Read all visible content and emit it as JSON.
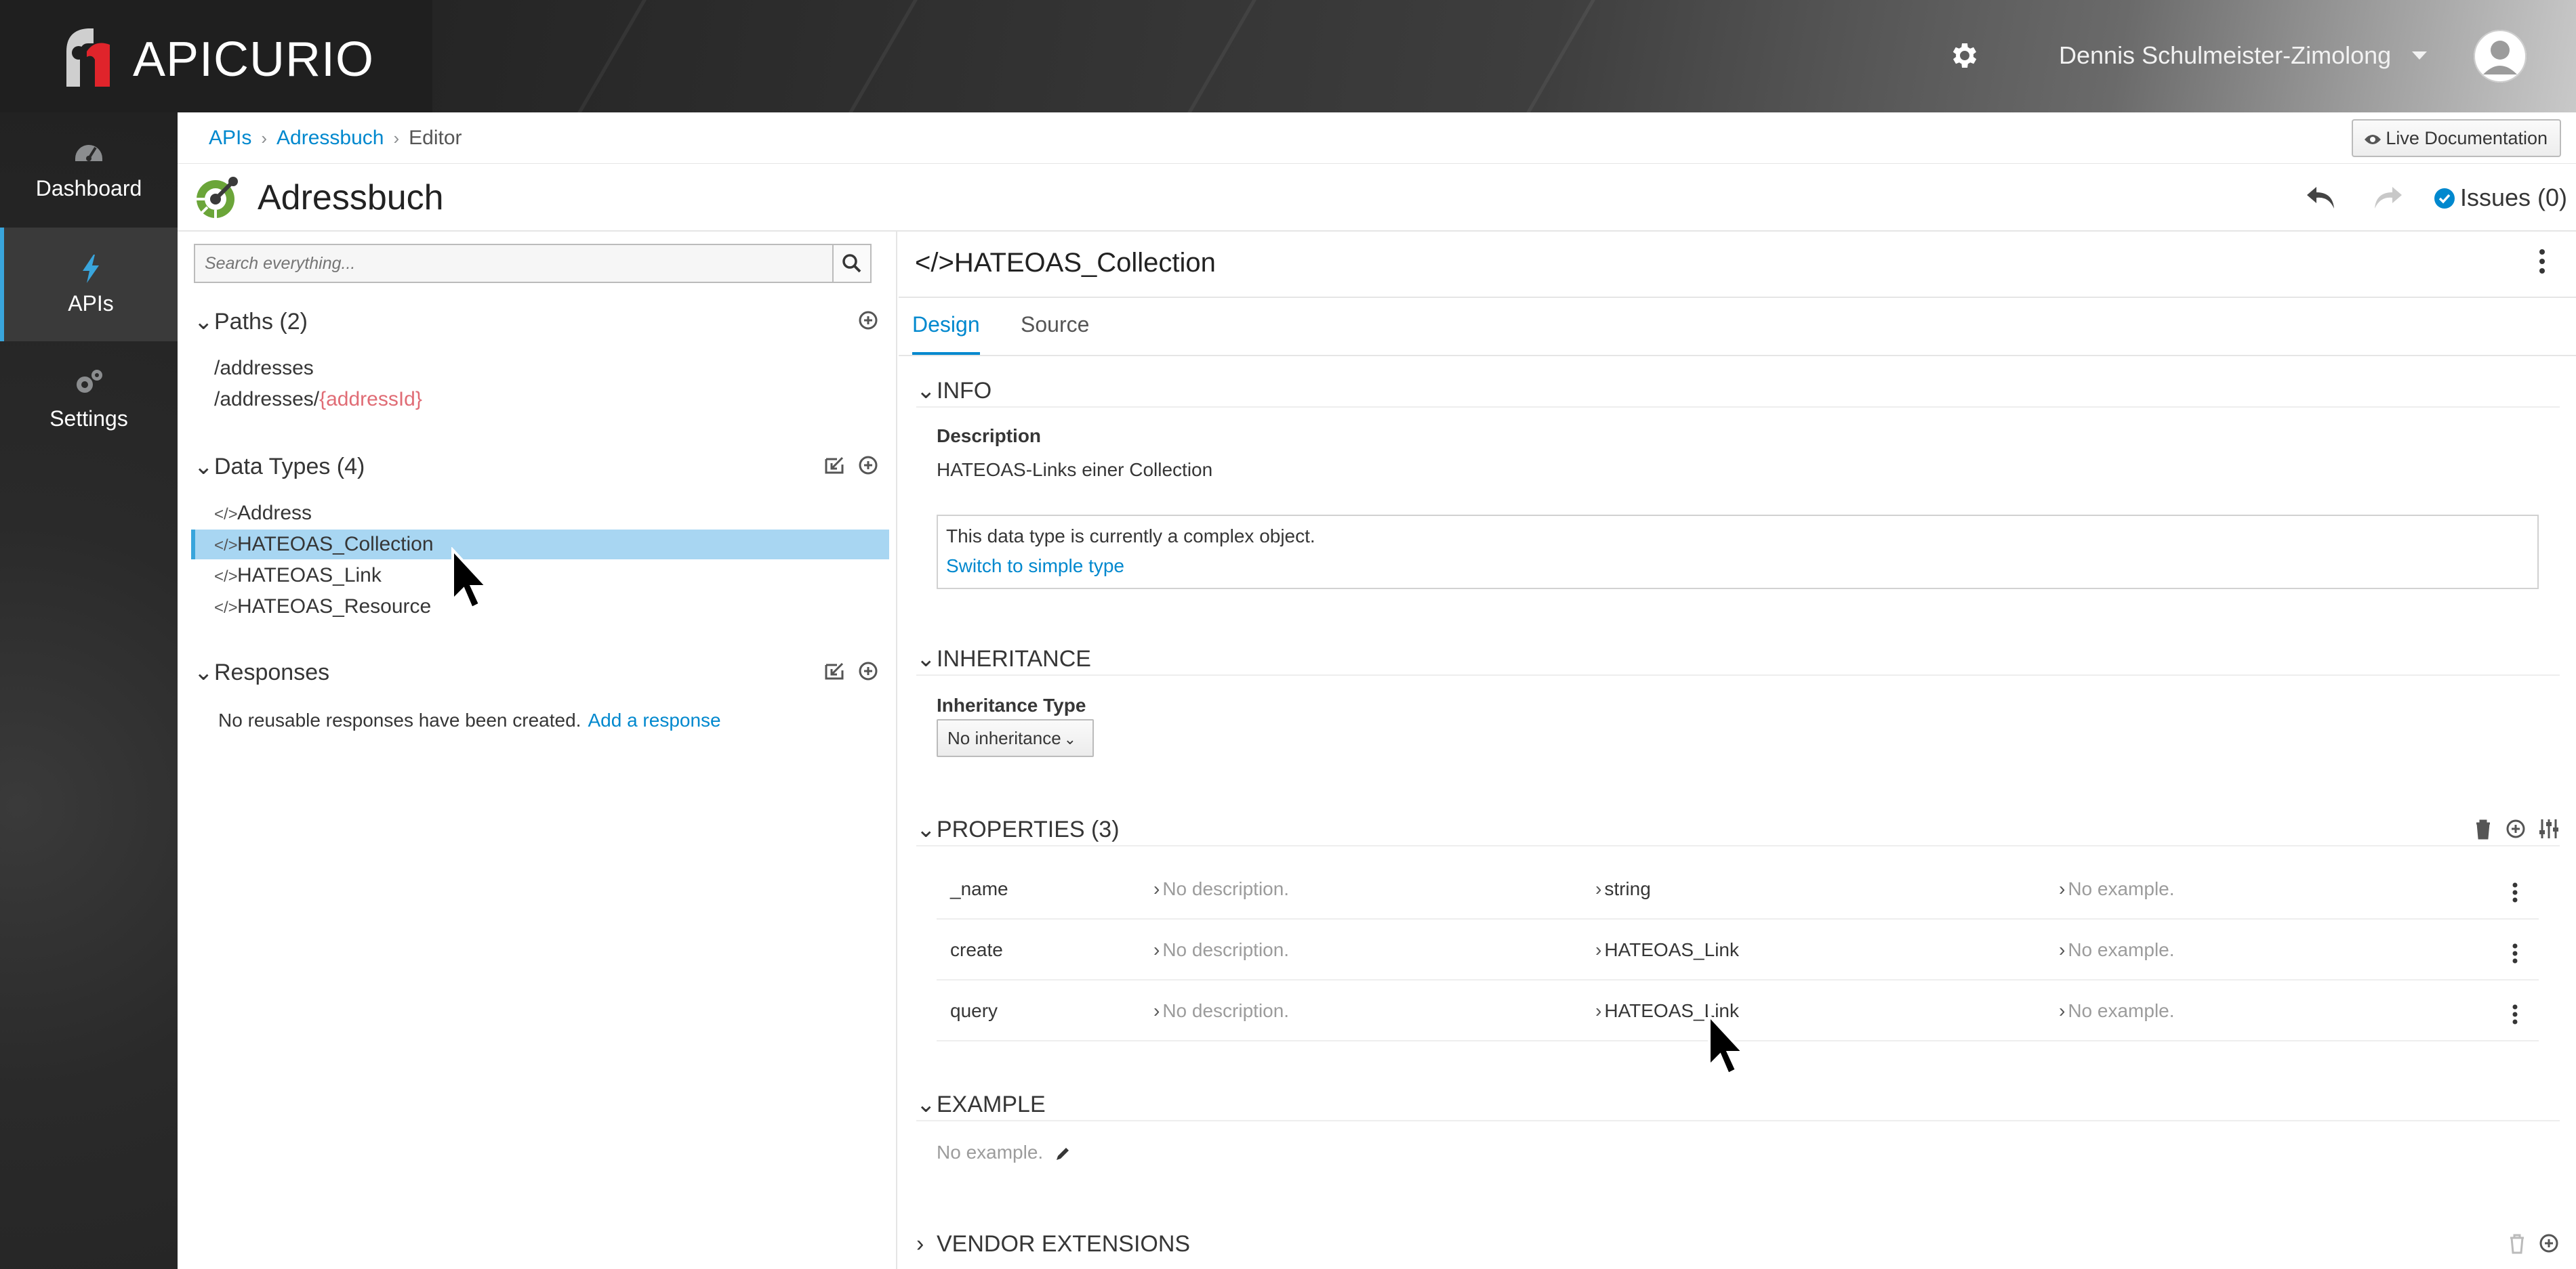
{
  "app": {
    "brand": "APICURIO",
    "user_name": "Dennis Schulmeister-Zimolong"
  },
  "leftnav": {
    "items": [
      {
        "label": "Dashboard",
        "icon": "dashboard-icon"
      },
      {
        "label": "APIs",
        "icon": "bolt-icon"
      },
      {
        "label": "Settings",
        "icon": "gears-icon"
      }
    ]
  },
  "breadcrumb": {
    "items": [
      "APIs",
      "Adressbuch",
      "Editor"
    ],
    "live_doc": "Live Documentation"
  },
  "title": {
    "api_name": "Adressbuch",
    "issues": "Issues (0)"
  },
  "navigator": {
    "search_placeholder": "Search everything...",
    "paths": {
      "title": "Paths (2)",
      "items": [
        {
          "prefix": "/addresses",
          "param": ""
        },
        {
          "prefix": "/addresses/",
          "param": "{addressId}"
        }
      ]
    },
    "data_types": {
      "title": "Data Types (4)",
      "items": [
        "Address",
        "HATEOAS_Collection",
        "HATEOAS_Link",
        "HATEOAS_Resource"
      ],
      "selected": "HATEOAS_Collection"
    },
    "responses": {
      "title": "Responses",
      "empty_text": "No reusable responses have been created.",
      "add_link": "Add a response"
    }
  },
  "editor": {
    "title": "HATEOAS_Collection",
    "tabs": [
      {
        "label": "Design",
        "active": true
      },
      {
        "label": "Source",
        "active": false
      }
    ],
    "info": {
      "heading": "INFO",
      "description_label": "Description",
      "description": "HATEOAS-Links einer Collection",
      "complex_msg": "This data type is currently a complex object.",
      "switch_link": "Switch to simple type"
    },
    "inheritance": {
      "heading": "INHERITANCE",
      "label": "Inheritance Type",
      "value": "No inheritance"
    },
    "properties": {
      "heading": "PROPERTIES (3)",
      "rows": [
        {
          "name": "_name",
          "description": "No description.",
          "type": "string",
          "example": "No example."
        },
        {
          "name": "create",
          "description": "No description.",
          "type": "HATEOAS_Link",
          "example": "No example."
        },
        {
          "name": "query",
          "description": "No description.",
          "type": "HATEOAS_Link",
          "example": "No example."
        }
      ]
    },
    "example": {
      "heading": "EXAMPLE",
      "text": "No example."
    },
    "vendor_extensions": {
      "heading": "VENDOR EXTENSIONS"
    }
  },
  "colors": {
    "accent": "#0088ce",
    "selected_bg": "#a8d6f2",
    "nav_bg": "#292929",
    "param": "#e06c75"
  }
}
